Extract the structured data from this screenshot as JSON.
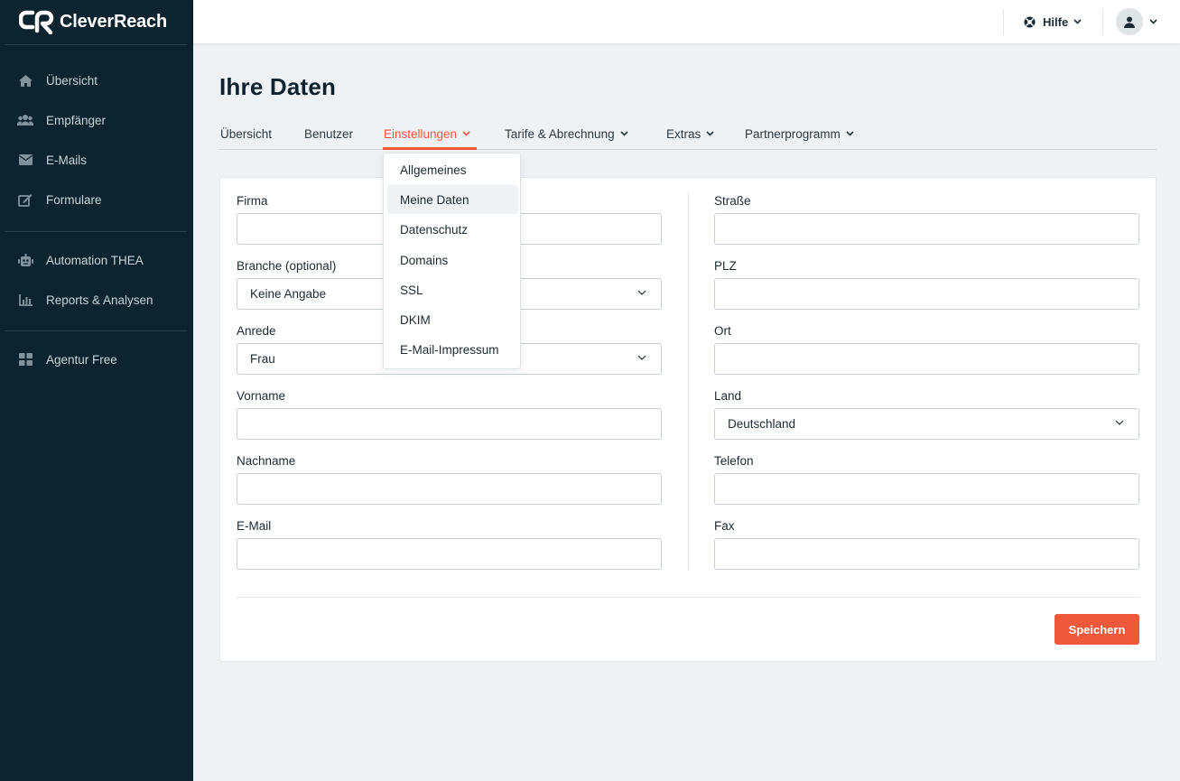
{
  "app": {
    "name": "CleverReach"
  },
  "sidebar": {
    "items": [
      {
        "label": "Übersicht",
        "icon": "home-icon"
      },
      {
        "label": "Empfänger",
        "icon": "users-icon"
      },
      {
        "label": "E-Mails",
        "icon": "envelope-icon"
      },
      {
        "label": "Formulare",
        "icon": "edit-form-icon"
      },
      {
        "label": "Automation THEA",
        "icon": "robot-icon"
      },
      {
        "label": "Reports & Analysen",
        "icon": "bar-chart-icon"
      },
      {
        "label": "Agentur Free",
        "icon": "grid-icon"
      }
    ]
  },
  "topbar": {
    "help_label": "Hilfe"
  },
  "page": {
    "title": "Ihre Daten"
  },
  "tabs": [
    {
      "label": "Übersicht"
    },
    {
      "label": "Benutzer"
    },
    {
      "label": "Einstellungen",
      "active": true
    },
    {
      "label": "Tarife & Abrechnung"
    },
    {
      "label": "Extras"
    },
    {
      "label": "Partnerprogramm"
    }
  ],
  "dropdown": {
    "items": [
      "Allgemeines",
      "Meine Daten",
      "Datenschutz",
      "Domains",
      "SSL",
      "DKIM",
      "E-Mail-Impressum"
    ],
    "highlighted": "Meine Daten"
  },
  "form": {
    "left": [
      {
        "label": "Firma",
        "value": ""
      },
      {
        "label": "Branche (optional)",
        "value": "Keine Angabe",
        "type": "select"
      },
      {
        "label": "Anrede",
        "value": "Frau",
        "type": "select"
      },
      {
        "label": "Vorname",
        "value": ""
      },
      {
        "label": "Nachname",
        "value": ""
      },
      {
        "label": "E-Mail",
        "value": ""
      }
    ],
    "right": [
      {
        "label": "Straße",
        "value": ""
      },
      {
        "label": "PLZ",
        "value": ""
      },
      {
        "label": "Ort",
        "value": ""
      },
      {
        "label": "Land",
        "value": "Deutschland",
        "type": "select"
      },
      {
        "label": "Telefon",
        "value": ""
      },
      {
        "label": "Fax",
        "value": ""
      }
    ],
    "save_label": "Speichern"
  },
  "colors": {
    "sidebar_bg": "#0b2430",
    "accent": "#f0583a",
    "page_bg": "#eef2f5"
  }
}
